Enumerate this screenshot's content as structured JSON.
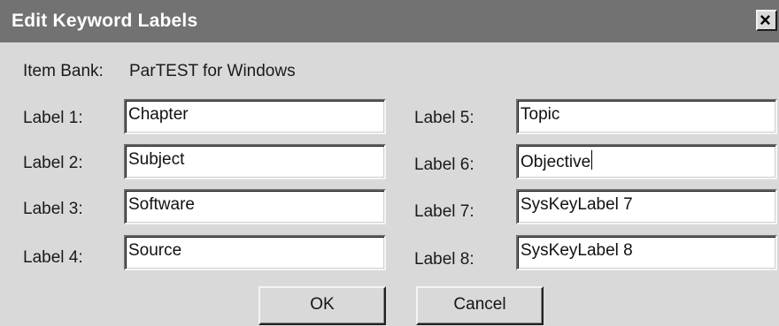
{
  "dialog": {
    "title": "Edit Keyword Labels",
    "close_glyph": "×"
  },
  "item_bank": {
    "label": "Item Bank:",
    "value": "ParTEST for Windows"
  },
  "labels": [
    {
      "label": "Label 1:",
      "value": "Chapter"
    },
    {
      "label": "Label 2:",
      "value": "Subject"
    },
    {
      "label": "Label 3:",
      "value": "Software"
    },
    {
      "label": "Label 4:",
      "value": "Source"
    },
    {
      "label": "Label 5:",
      "value": "Topic"
    },
    {
      "label": "Label 6:",
      "value": "Objective"
    },
    {
      "label": "Label 7:",
      "value": "SysKeyLabel 7"
    },
    {
      "label": "Label 8:",
      "value": "SysKeyLabel 8"
    }
  ],
  "buttons": {
    "ok": "OK",
    "cancel": "Cancel"
  }
}
